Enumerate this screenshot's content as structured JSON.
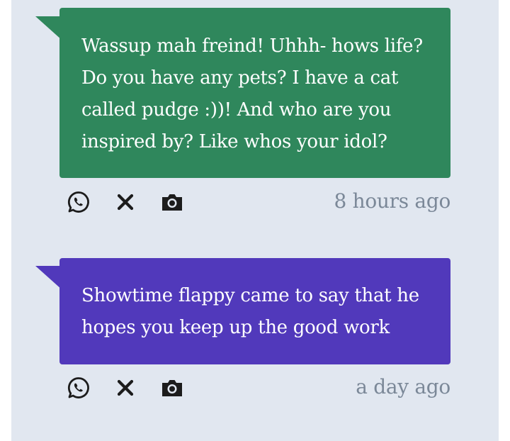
{
  "messages": [
    {
      "text": "Wassup mah freind! Uhhh- hows life? Do you have any pets? I have a cat called pudge :))! And who are you inspired by? Like whos your idol?",
      "timestamp": "8 hours ago",
      "bubble_color": "#2f875c"
    },
    {
      "text": "Showtime flappy came to say that he hopes you keep up the good work",
      "timestamp": "a day ago",
      "bubble_color": "#5139bb"
    }
  ],
  "actions": {
    "share_icon": "whatsapp-icon",
    "delete_icon": "close-icon",
    "screenshot_icon": "camera-icon"
  },
  "colors": {
    "background": "#e1e7f0",
    "timestamp": "#7b8898",
    "icon": "#1c1c1c"
  }
}
